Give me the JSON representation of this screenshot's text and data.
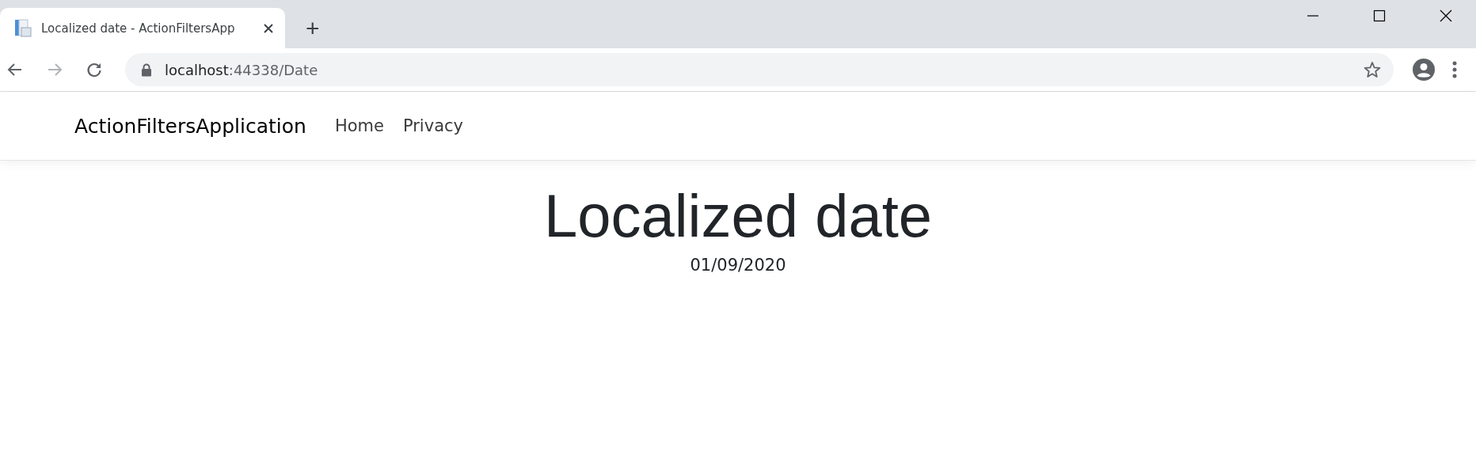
{
  "browser": {
    "tab": {
      "title": "Localized date - ActionFiltersApp",
      "selected": true
    },
    "new_tab": "+",
    "address": {
      "host": "localhost",
      "path": ":44338/Date"
    }
  },
  "navbar": {
    "brand": "ActionFiltersApplication",
    "links": [
      "Home",
      "Privacy"
    ]
  },
  "page": {
    "heading": "Localized date",
    "date": "01/09/2020"
  }
}
